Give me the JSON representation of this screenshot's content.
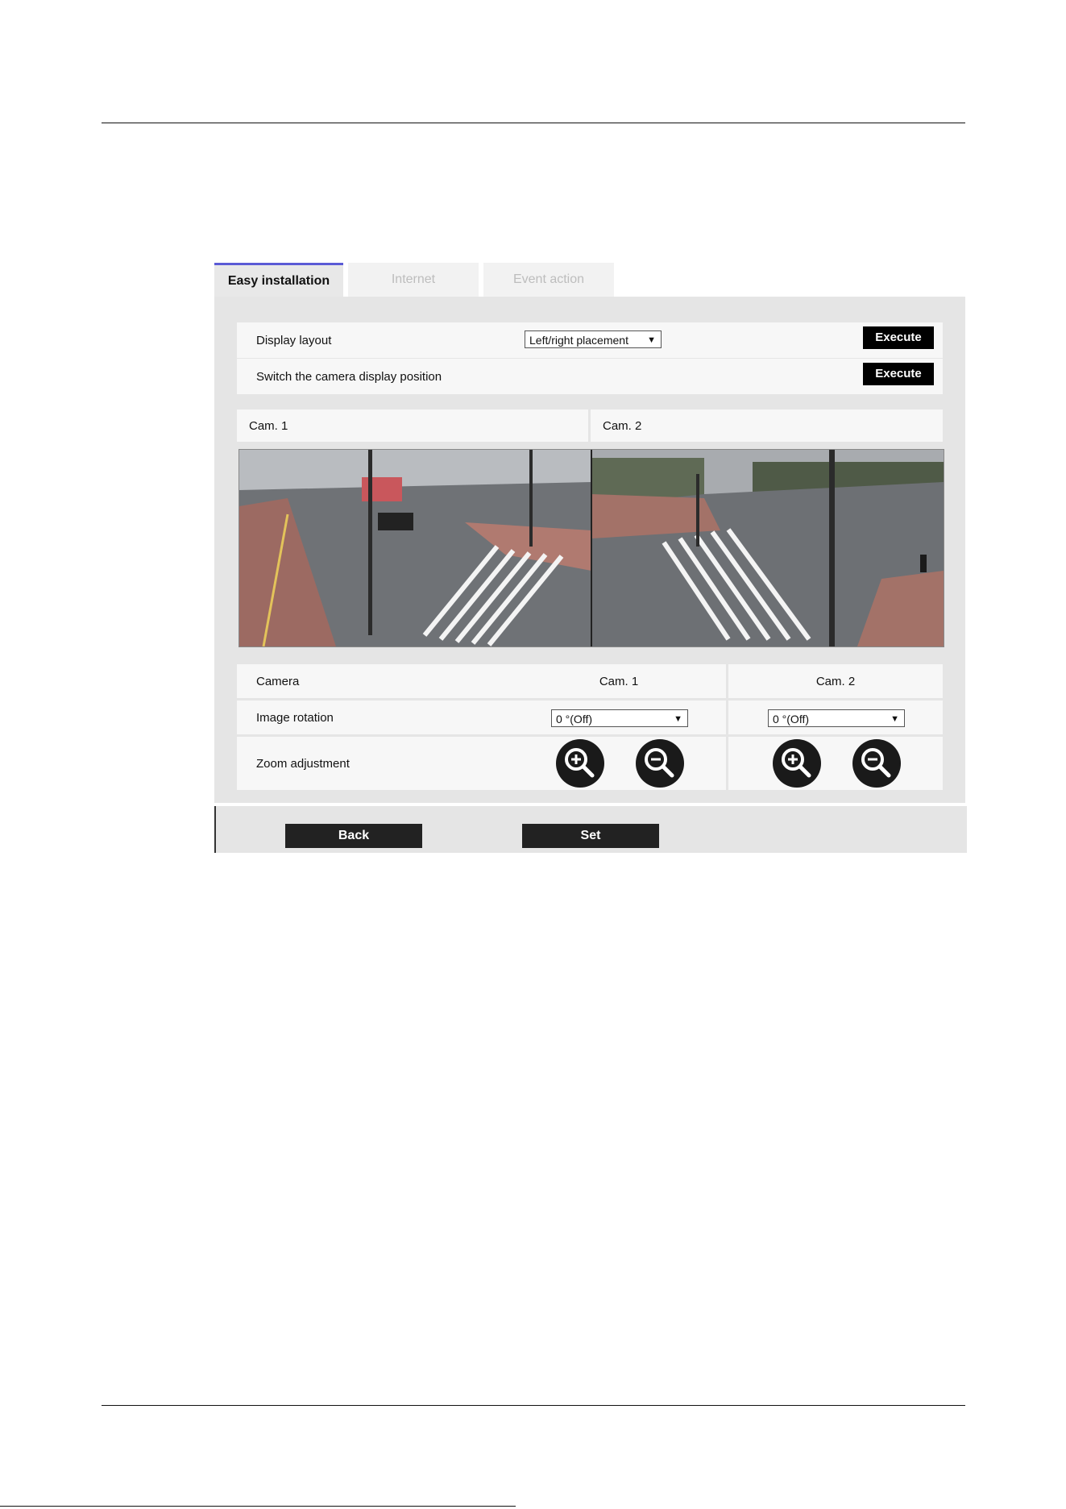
{
  "tabs": [
    {
      "label": "Easy installation",
      "active": true
    },
    {
      "label": "Internet",
      "active": false
    },
    {
      "label": "Event action",
      "active": false
    }
  ],
  "settings": {
    "display_layout_label": "Display layout",
    "display_layout_value": "Left/right placement",
    "switch_label": "Switch the camera display position",
    "execute_label": "Execute"
  },
  "preview": {
    "cam1_label": "Cam. 1",
    "cam2_label": "Cam. 2"
  },
  "camera_table": {
    "header_label": "Camera",
    "cam1": "Cam. 1",
    "cam2": "Cam. 2",
    "rotation_label": "Image rotation",
    "rotation_cam1": "0 °(Off)",
    "rotation_cam2": "0 °(Off)",
    "zoom_label": "Zoom adjustment"
  },
  "actions": {
    "back_label": "Back",
    "set_label": "Set"
  },
  "colors": {
    "active_tab_accent": "#5a5ad6",
    "button_bg": "#000000"
  }
}
